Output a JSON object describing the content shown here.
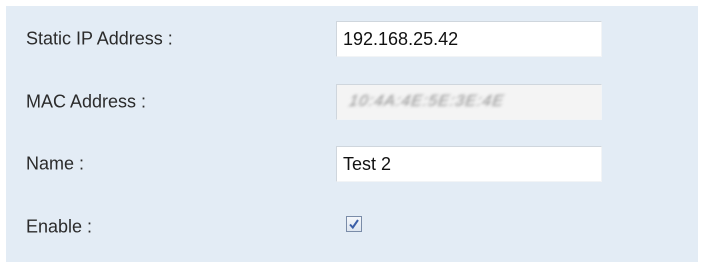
{
  "form": {
    "static_ip": {
      "label": "Static IP Address :",
      "value": "192.168.25.42"
    },
    "mac_address": {
      "label": "MAC Address :",
      "value_obscured": "10:4A:4E:5E:3E:4E"
    },
    "name": {
      "label": "Name :",
      "value": "Test 2"
    },
    "enable": {
      "label": "Enable :",
      "checked": true
    }
  },
  "colors": {
    "panel_background": "#e3ecf5",
    "checkmark": "#3b5fa8"
  }
}
